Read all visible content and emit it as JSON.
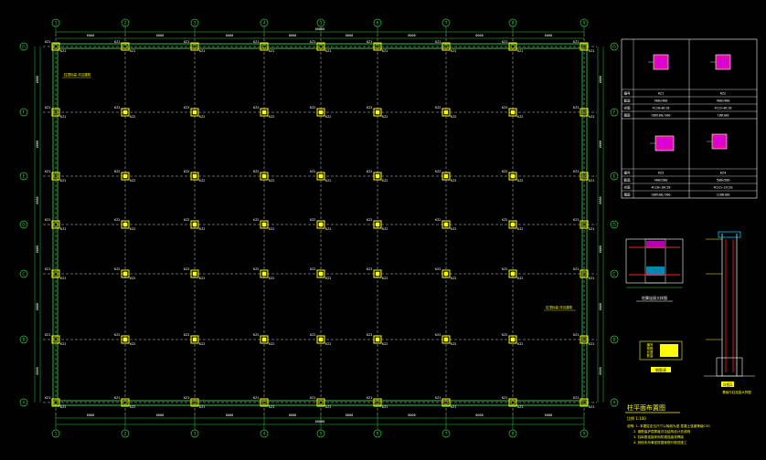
{
  "colors": {
    "background": "#000000",
    "axis": "#2ecc40",
    "column": "#ffff00",
    "grid": "#ffffff",
    "note": "#ffff00",
    "rebar": "#ff2020",
    "section": "#ff00ff",
    "dim": "#2ecc40"
  },
  "grid": {
    "col_axes": [
      "1",
      "2",
      "3",
      "4",
      "5",
      "6",
      "7",
      "8",
      "9"
    ],
    "row_axes": [
      "G",
      "F",
      "E",
      "D",
      "C",
      "B",
      "A"
    ],
    "col_spacings": [
      "6000",
      "8000",
      "8000",
      "8000",
      "8000",
      "8000",
      "8000",
      "6000"
    ],
    "row_spacings": [
      "6000",
      "6000",
      "6000",
      "6000",
      "6000",
      "6000"
    ],
    "total_width": "60000",
    "total_height": "36000"
  },
  "column_label": "KZ1",
  "column_label_alt": "KZ2",
  "notes": {
    "top_left": "柱顶标高 详见建筑",
    "right_mid": "柱顶标高 详见建筑"
  },
  "schedule": {
    "rows": [
      {
        "name": "KZ1",
        "size": "400x400",
        "rebar": "4C20+8C18",
        "stirrup": "C8@100/200"
      },
      {
        "name": "KZ2",
        "size": "400x400",
        "rebar": "4C22+8C18",
        "stirrup": "C8@100"
      },
      {
        "name": "KZ3",
        "size": "400x500",
        "rebar": "4C20+10C18",
        "stirrup": "C8@100/200"
      },
      {
        "name": "KZ4",
        "size": "500x500",
        "rebar": "4C22+12C20",
        "stirrup": "C10@100"
      }
    ],
    "header_labels": [
      "编号",
      "截面",
      "纵筋",
      "箍筋"
    ]
  },
  "detail1": {
    "title": "柱脚连接大样图"
  },
  "detail2": {
    "title": "钢筋表",
    "rows": [
      "编号",
      "规格",
      "长度",
      "数量"
    ]
  },
  "detail3": {
    "title": "详图1",
    "caption": "基础与柱连接大样图"
  },
  "plan_title": "柱平面布置图",
  "plan_subtitle": "比例 1:100",
  "notes_block": [
    "说明: 1. 本图柱定位尺寸以轴线为准 混凝土强度等级C30",
    "2. 钢筋保护层厚度详见结构设计总说明",
    "3. 柱纵筋连接采用机械连接或焊接",
    "4. 其他未尽事宜按国家现行规范施工"
  ]
}
